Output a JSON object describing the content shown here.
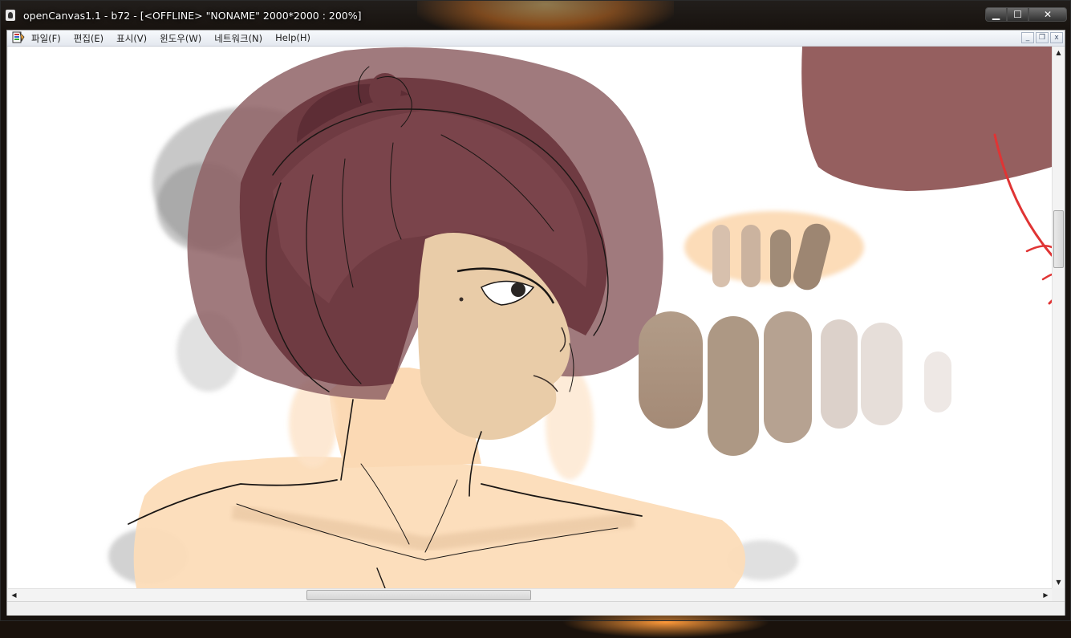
{
  "window": {
    "title": "openCanvas1.1 - b72 - [<OFFLINE>  \"NONAME\" 2000*2000 : 200%]",
    "minimize_glyph": "▁",
    "maximize_glyph": "☐",
    "close_glyph": "✕"
  },
  "menu": {
    "doc_icon": "document-paint-icon",
    "items": [
      {
        "label": "파일(F)"
      },
      {
        "label": "편집(E)"
      },
      {
        "label": "표시(V)"
      },
      {
        "label": "윈도우(W)"
      },
      {
        "label": "네트워크(N)"
      },
      {
        "label": "Help(H)"
      }
    ],
    "mdi_minimize": "_",
    "mdi_restore": "❐",
    "mdi_close": "x"
  },
  "canvas": {
    "document_name": "NONAME",
    "document_size": "2000*2000",
    "zoom": "200%",
    "status": "OFFLINE",
    "colors": {
      "hair": "#6a343a",
      "hair_wash": "#8c5a5e",
      "skin": "#fcdcb8",
      "skin_shadow": "#e9c8a4",
      "line": "#1a1614",
      "swatch_dark": "#a58a74",
      "swatch_mid": "#b8a28c",
      "swatch_light": "#dcd0c8",
      "red_stroke": "#e03434"
    }
  },
  "scrollbars": {
    "vertical_position": 0.33,
    "horizontal_position": 0.36,
    "horizontal_visible_fraction": 0.22,
    "up_glyph": "▲",
    "down_glyph": "▼",
    "left_glyph": "◀",
    "right_glyph": "▶"
  }
}
